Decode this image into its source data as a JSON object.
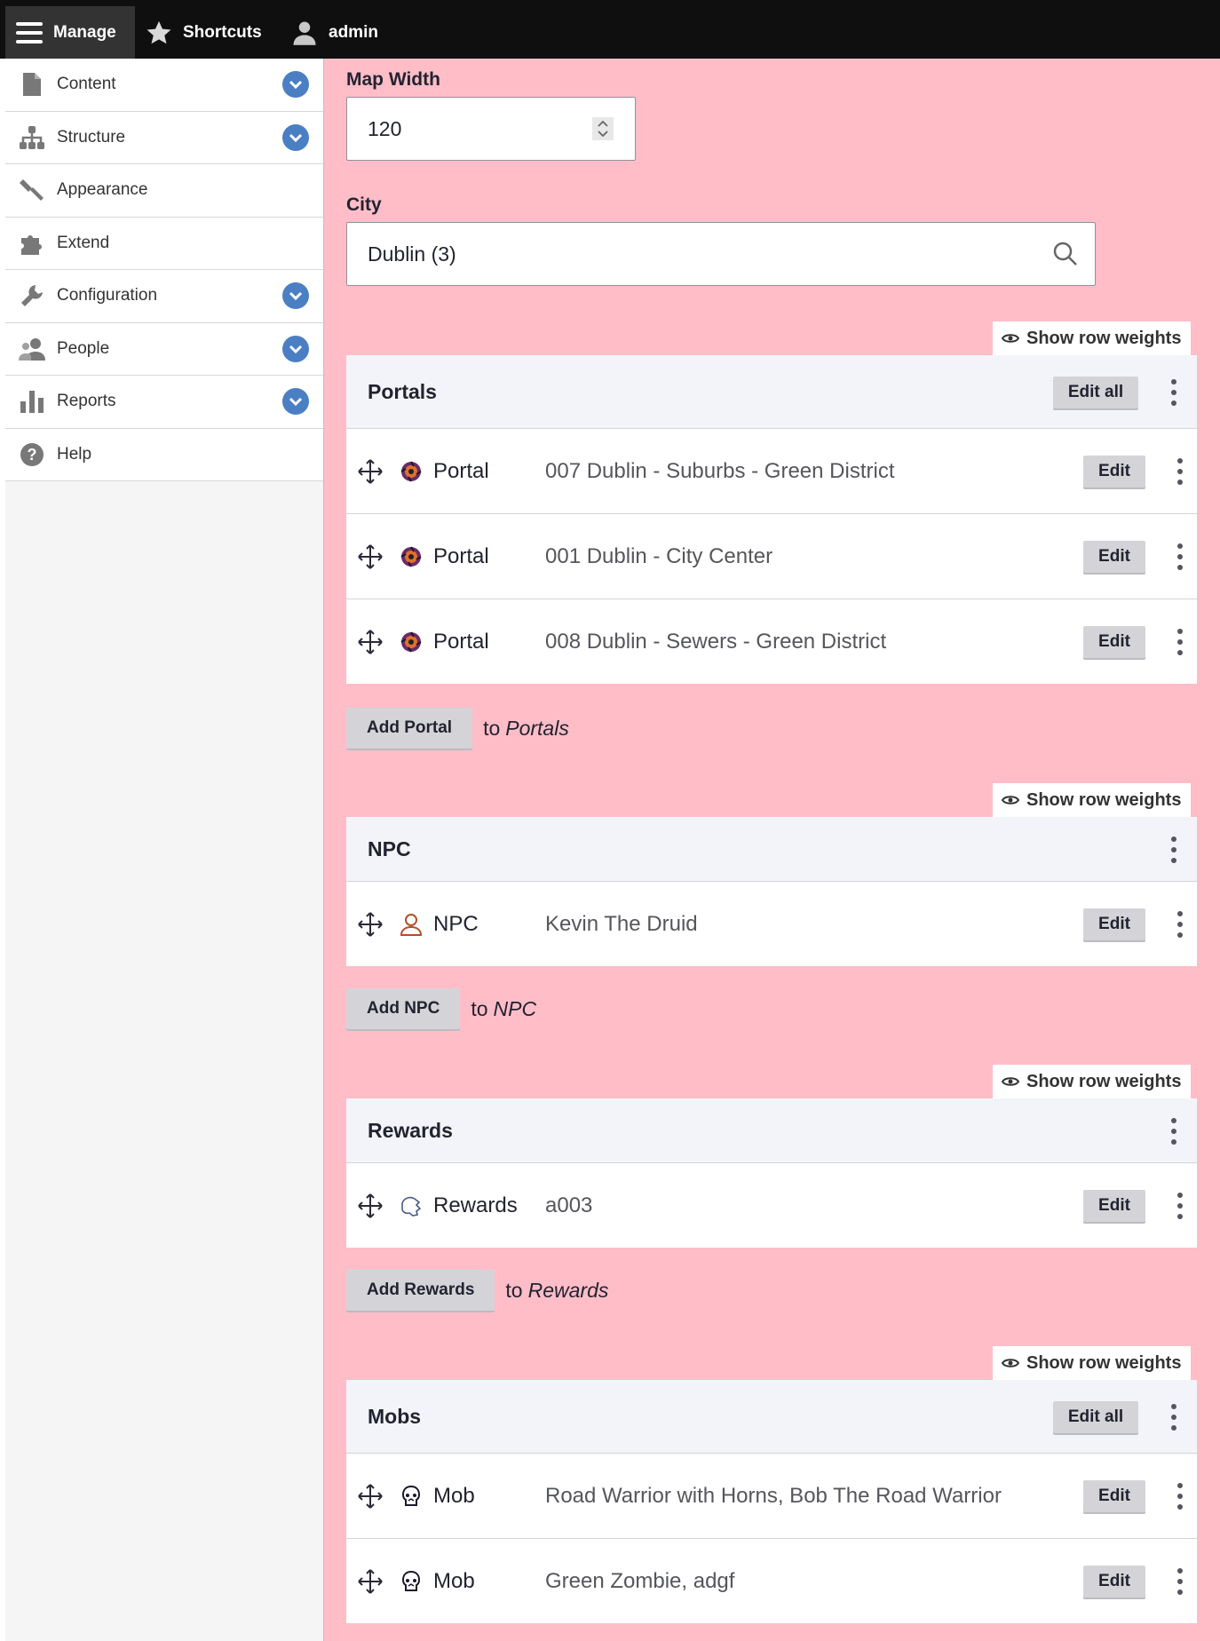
{
  "toolbar": {
    "manage_label": "Manage",
    "shortcuts_label": "Shortcuts",
    "user_label": "admin"
  },
  "sidebar": {
    "items": [
      {
        "label": "Content",
        "icon": "document-icon",
        "expandable": true
      },
      {
        "label": "Structure",
        "icon": "sitemap-icon",
        "expandable": true
      },
      {
        "label": "Appearance",
        "icon": "paintbrush-icon",
        "expandable": false
      },
      {
        "label": "Extend",
        "icon": "puzzle-icon",
        "expandable": false
      },
      {
        "label": "Configuration",
        "icon": "wrench-icon",
        "expandable": true
      },
      {
        "label": "People",
        "icon": "people-icon",
        "expandable": true
      },
      {
        "label": "Reports",
        "icon": "bar-chart-icon",
        "expandable": true
      },
      {
        "label": "Help",
        "icon": "help-icon",
        "expandable": false
      }
    ]
  },
  "form": {
    "map_width_label": "Map Width",
    "map_width_value": "120",
    "city_label": "City",
    "city_value": "Dublin (3)"
  },
  "show_row_weights_label": "Show row weights",
  "edit_all_label": "Edit all",
  "edit_label": "Edit",
  "to_label": "to",
  "sections": [
    {
      "title": "Portals",
      "has_edit_all": true,
      "add_label": "Add Portal",
      "rows": [
        {
          "type": "Portal",
          "name": "007 Dublin - Suburbs - Green District",
          "icon": "portal-icon"
        },
        {
          "type": "Portal",
          "name": "001 Dublin - City Center",
          "icon": "portal-icon"
        },
        {
          "type": "Portal",
          "name": "008 Dublin - Sewers - Green District",
          "icon": "portal-icon"
        }
      ]
    },
    {
      "title": "NPC",
      "has_edit_all": false,
      "add_label": "Add NPC",
      "rows": [
        {
          "type": "NPC",
          "name": "Kevin The Druid",
          "icon": "npc-person-icon"
        }
      ]
    },
    {
      "title": "Rewards",
      "has_edit_all": false,
      "add_label": "Add Rewards",
      "rows": [
        {
          "type": "Rewards",
          "name": "a003",
          "icon": "rewards-icon"
        }
      ]
    },
    {
      "title": "Mobs",
      "has_edit_all": true,
      "add_label": "",
      "rows": [
        {
          "type": "Mob",
          "name": "Road Warrior with Horns, Bob The Road Warrior",
          "icon": "mob-icon"
        },
        {
          "type": "Mob",
          "name": "Green Zombie, adgf",
          "icon": "mob-icon"
        }
      ]
    }
  ],
  "colors": {
    "page_background": "#ffbdc8",
    "toolbar": "#0f0f0f",
    "accent_blue": "#4a7fc3",
    "button_gray": "#d4d4d8"
  }
}
